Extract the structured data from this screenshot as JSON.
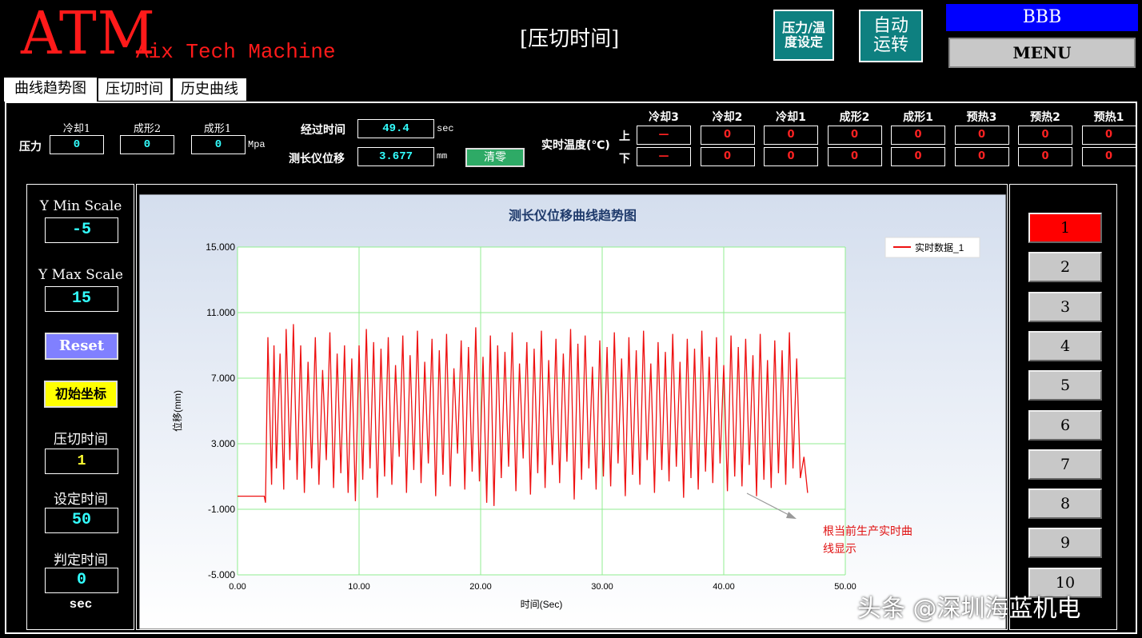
{
  "header": {
    "logo": "ATM",
    "subtitle": "Aix Tech Machine",
    "screen_title": "[压切时间]",
    "pressure_temp_btn": "压力/温\n度设定",
    "auto_run_btn": "自动\n运转",
    "user": "BBB",
    "menu": "MENU"
  },
  "tabs": [
    "曲线趋势图",
    "压切时间",
    "历史曲线"
  ],
  "pressure": {
    "label": "压力",
    "unit": "Mpa",
    "fields": [
      {
        "name": "冷却1",
        "value": "0"
      },
      {
        "name": "成形2",
        "value": "0"
      },
      {
        "name": "成形1",
        "value": "0"
      }
    ]
  },
  "elapsed": {
    "label": "经过时间",
    "value": "49.4",
    "unit": "sec"
  },
  "gauge": {
    "label": "测长仪位移",
    "value": "3.677",
    "unit": "mm",
    "zero_btn": "清零"
  },
  "temperature": {
    "label": "实时温度(℃)",
    "upper": "上",
    "lower": "下",
    "columns": [
      "冷却3",
      "冷却2",
      "冷却1",
      "成形2",
      "成形1",
      "预热3",
      "预热2",
      "预热1"
    ],
    "upper_values": [
      "—",
      "0",
      "0",
      "0",
      "0",
      "0",
      "0",
      "0"
    ],
    "lower_values": [
      "—",
      "0",
      "0",
      "0",
      "0",
      "0",
      "0",
      "0"
    ]
  },
  "sidebar": {
    "ymin_label": "Y Min Scale",
    "ymin_value": "-5",
    "ymax_label": "Y Max Scale",
    "ymax_value": "15",
    "reset_btn": "Reset",
    "init_btn": "初始坐标",
    "cut_time_label": "压切时间",
    "cut_time_value": "1",
    "set_time_label": "设定时间",
    "set_time_value": "50",
    "judge_time_label": "判定时间",
    "judge_time_value": "0",
    "unit": "sec"
  },
  "pages": [
    "1",
    "2",
    "3",
    "4",
    "5",
    "6",
    "7",
    "8",
    "9",
    "10"
  ],
  "active_page": "1",
  "annotation": "根当前生产实时曲\n线显示",
  "watermark": "头条 @深圳海蓝机电",
  "colors": {
    "teal": "#0e8080",
    "blue": "#0000ff",
    "line": "#ee1111",
    "grid": "#90ee90",
    "active": "#ff0000"
  },
  "chart_data": {
    "type": "line",
    "title": "测长仪位移曲线趋势图",
    "xlabel": "时间(Sec)",
    "ylabel": "位移(mm)",
    "xlim": [
      0,
      50
    ],
    "ylim": [
      -5,
      15
    ],
    "x_ticks": [
      "0.00",
      "10.00",
      "20.00",
      "30.00",
      "40.00",
      "50.00"
    ],
    "y_ticks": [
      "15.000",
      "11.000",
      "7.000",
      "3.000",
      "-1.000",
      "-5.000"
    ],
    "legend": "top-right",
    "grid": true,
    "series": [
      {
        "name": "实时数据_1",
        "points": [
          [
            0.0,
            -0.2
          ],
          [
            2.2,
            -0.2
          ],
          [
            2.3,
            -0.6
          ],
          [
            2.5,
            9.5
          ],
          [
            2.8,
            0.5
          ],
          [
            3.0,
            9.0
          ],
          [
            3.2,
            1.5
          ],
          [
            3.5,
            8.5
          ],
          [
            3.8,
            0.2
          ],
          [
            4.0,
            10.0
          ],
          [
            4.3,
            2.0
          ],
          [
            4.6,
            10.3
          ],
          [
            4.9,
            0.8
          ],
          [
            5.2,
            9.0
          ],
          [
            5.5,
            0.0
          ],
          [
            5.8,
            8.0
          ],
          [
            6.1,
            1.5
          ],
          [
            6.4,
            9.5
          ],
          [
            6.7,
            0.5
          ],
          [
            7.0,
            7.5
          ],
          [
            7.3,
            2.0
          ],
          [
            7.6,
            9.8
          ],
          [
            7.9,
            0.3
          ],
          [
            8.2,
            8.5
          ],
          [
            8.5,
            1.2
          ],
          [
            8.8,
            9.0
          ],
          [
            9.1,
            0.0
          ],
          [
            9.4,
            8.2
          ],
          [
            9.7,
            -0.5
          ],
          [
            10.0,
            9.0
          ],
          [
            10.3,
            0.8
          ],
          [
            10.6,
            10.0
          ],
          [
            10.9,
            1.5
          ],
          [
            11.2,
            9.2
          ],
          [
            11.5,
            -0.3
          ],
          [
            11.8,
            8.8
          ],
          [
            12.1,
            1.0
          ],
          [
            12.4,
            9.5
          ],
          [
            12.7,
            0.5
          ],
          [
            13.0,
            7.8
          ],
          [
            13.3,
            2.2
          ],
          [
            13.6,
            9.6
          ],
          [
            13.9,
            0.0
          ],
          [
            14.2,
            8.4
          ],
          [
            14.5,
            1.4
          ],
          [
            14.8,
            9.9
          ],
          [
            15.1,
            0.6
          ],
          [
            15.4,
            8.0
          ],
          [
            15.7,
            1.8
          ],
          [
            16.0,
            9.4
          ],
          [
            16.3,
            -0.2
          ],
          [
            16.6,
            8.7
          ],
          [
            16.9,
            1.1
          ],
          [
            17.2,
            9.7
          ],
          [
            17.5,
            0.4
          ],
          [
            17.8,
            7.6
          ],
          [
            18.1,
            2.4
          ],
          [
            18.4,
            9.3
          ],
          [
            18.7,
            0.2
          ],
          [
            19.0,
            8.9
          ],
          [
            19.3,
            1.3
          ],
          [
            19.6,
            10.1
          ],
          [
            19.9,
            0.7
          ],
          [
            20.2,
            8.3
          ],
          [
            20.5,
            -0.6
          ],
          [
            20.8,
            9.6
          ],
          [
            21.1,
            -0.8
          ],
          [
            21.4,
            9.0
          ],
          [
            21.7,
            0.9
          ],
          [
            22.0,
            8.6
          ],
          [
            22.3,
            1.6
          ],
          [
            22.6,
            9.8
          ],
          [
            22.9,
            0.1
          ],
          [
            23.2,
            7.9
          ],
          [
            23.5,
            2.1
          ],
          [
            23.8,
            9.2
          ],
          [
            24.1,
            -0.1
          ],
          [
            24.4,
            8.8
          ],
          [
            24.7,
            1.2
          ],
          [
            25.0,
            9.9
          ],
          [
            25.3,
            0.3
          ],
          [
            25.6,
            8.1
          ],
          [
            25.9,
            1.7
          ],
          [
            26.2,
            9.4
          ],
          [
            26.5,
            0.6
          ],
          [
            26.8,
            8.5
          ],
          [
            27.1,
            1.9
          ],
          [
            27.4,
            10.0
          ],
          [
            27.7,
            -0.4
          ],
          [
            28.0,
            9.1
          ],
          [
            28.3,
            0.8
          ],
          [
            28.6,
            9.6
          ],
          [
            28.9,
            1.5
          ],
          [
            29.2,
            7.7
          ],
          [
            29.5,
            0.2
          ],
          [
            29.8,
            9.3
          ],
          [
            30.1,
            1.0
          ],
          [
            30.4,
            8.9
          ],
          [
            30.7,
            0.4
          ],
          [
            31.0,
            9.8
          ],
          [
            31.3,
            1.8
          ],
          [
            31.6,
            8.2
          ],
          [
            31.9,
            -0.2
          ],
          [
            32.2,
            9.5
          ],
          [
            32.5,
            1.1
          ],
          [
            32.8,
            8.7
          ],
          [
            33.1,
            0.5
          ],
          [
            33.4,
            9.9
          ],
          [
            33.7,
            2.0
          ],
          [
            34.0,
            7.9
          ],
          [
            34.3,
            0.0
          ],
          [
            34.6,
            9.2
          ],
          [
            34.9,
            1.4
          ],
          [
            35.2,
            8.6
          ],
          [
            35.5,
            0.7
          ],
          [
            35.8,
            9.7
          ],
          [
            36.1,
            1.6
          ],
          [
            36.4,
            8.0
          ],
          [
            36.7,
            -0.3
          ],
          [
            37.0,
            9.4
          ],
          [
            37.3,
            0.9
          ],
          [
            37.6,
            8.8
          ],
          [
            37.9,
            0.2
          ],
          [
            38.2,
            9.9
          ],
          [
            38.5,
            1.3
          ],
          [
            38.8,
            8.3
          ],
          [
            39.1,
            0.6
          ],
          [
            39.4,
            9.5
          ],
          [
            39.7,
            1.8
          ],
          [
            40.0,
            7.8
          ],
          [
            40.3,
            0.1
          ],
          [
            40.6,
            9.6
          ],
          [
            40.9,
            1.0
          ],
          [
            41.2,
            8.9
          ],
          [
            41.5,
            0.4
          ],
          [
            41.8,
            9.4
          ],
          [
            42.1,
            1.7
          ],
          [
            42.4,
            8.4
          ],
          [
            42.7,
            -0.2
          ],
          [
            43.0,
            9.7
          ],
          [
            43.3,
            0.8
          ],
          [
            43.6,
            8.1
          ],
          [
            43.9,
            0.3
          ],
          [
            44.2,
            9.3
          ],
          [
            44.5,
            1.2
          ],
          [
            44.8,
            8.7
          ],
          [
            45.1,
            0.5
          ],
          [
            45.4,
            9.8
          ],
          [
            45.7,
            1.5
          ],
          [
            46.0,
            8.2
          ],
          [
            46.3,
            0.9
          ],
          [
            46.6,
            2.2
          ],
          [
            46.9,
            0.0
          ]
        ]
      }
    ]
  }
}
